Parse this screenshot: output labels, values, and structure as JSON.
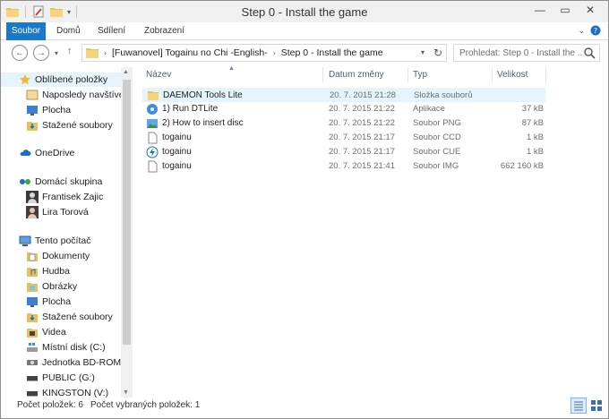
{
  "window": {
    "title": "Step 0 - Install the game"
  },
  "ribbon": {
    "tabs": [
      {
        "label": "Soubor"
      },
      {
        "label": "Domů"
      },
      {
        "label": "Sdílení"
      },
      {
        "label": "Zobrazení"
      }
    ]
  },
  "address": {
    "breadcrumbs": [
      "[Fuwanovel] Togainu no Chi -English-",
      "Step 0 - Install the game"
    ]
  },
  "search": {
    "placeholder": "Prohledat: Step 0 - Install the ..."
  },
  "navpane": {
    "favorites": "Oblíbené položky",
    "favorites_items": [
      "Naposledy navštíven",
      "Plocha",
      "Stažené soubory"
    ],
    "onedrive": "OneDrive",
    "homegroup": "Domácí skupina",
    "homegroup_items": [
      "Frantisek Zajic",
      "Lira Torová"
    ],
    "thispc": "Tento počítač",
    "thispc_items": [
      "Dokumenty",
      "Hudba",
      "Obrázky",
      "Plocha",
      "Stažené soubory",
      "Videa",
      "Místní disk (C:)",
      "Jednotka BD-ROM (D",
      "PUBLIC (G:)",
      "KINGSTON (V:)"
    ]
  },
  "columns": {
    "name": "Název",
    "date": "Datum změny",
    "type": "Typ",
    "size": "Velikost"
  },
  "files": [
    {
      "name": "DAEMON Tools Lite",
      "date": "20. 7. 2015 21:28",
      "type": "Složka souborů",
      "size": "",
      "icon": "folder-icon"
    },
    {
      "name": "1) Run DTLite",
      "date": "20. 7. 2015 21:22",
      "type": "Aplikace",
      "size": "37 kB",
      "icon": "application-icon"
    },
    {
      "name": "2) How to insert disc",
      "date": "20. 7. 2015 21:22",
      "type": "Soubor PNG",
      "size": "87 kB",
      "icon": "image-icon"
    },
    {
      "name": "togainu",
      "date": "20. 7. 2015 21:17",
      "type": "Soubor CCD",
      "size": "1 kB",
      "icon": "document-icon"
    },
    {
      "name": "togainu",
      "date": "20. 7. 2015 21:17",
      "type": "Soubor CUE",
      "size": "1 kB",
      "icon": "daemon-cue-icon"
    },
    {
      "name": "togainu",
      "date": "20. 7. 2015 21:41",
      "type": "Soubor IMG",
      "size": "662 160 kB",
      "icon": "document-icon"
    }
  ],
  "status": {
    "count": "Počet položek: 6",
    "selected": "Počet vybraných položek: 1"
  },
  "colors": {
    "accent": "#1979ca",
    "selection": "#e5f3fb",
    "header_text": "#4c607a"
  }
}
